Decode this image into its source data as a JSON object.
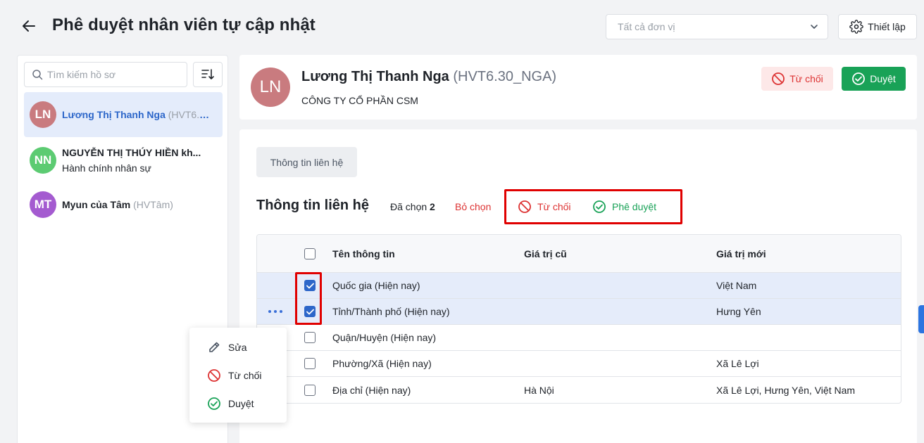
{
  "header": {
    "title": "Phê duyệt nhân viên tự cập nhật",
    "unit_select_placeholder": "Tất cả đơn vị",
    "setup_label": "Thiết lập"
  },
  "sidebar": {
    "search_placeholder": "Tìm kiếm hồ sơ",
    "items": [
      {
        "initials": "LN",
        "avatar_color": "#c97b7f",
        "name": "Lương Thị Thanh Nga",
        "code": "(HVT6.30_NGA)",
        "sub": "",
        "active": true
      },
      {
        "initials": "NN",
        "avatar_color": "#5ccb72",
        "name": "NGUYỄN THỊ THÚY HIỀN kh...",
        "code": "",
        "sub": "Hành chính nhân sự",
        "active": false
      },
      {
        "initials": "MT",
        "avatar_color": "#a45bd0",
        "name": "Myun của Tâm",
        "code": "(HVTâm)",
        "sub": "",
        "active": false
      }
    ]
  },
  "employee": {
    "initials": "LN",
    "avatar_color": "#c97b7f",
    "name": "Lương Thị Thanh Nga",
    "code": "(HVT6.30_NGA)",
    "company": "CÔNG TY CỔ PHẦN CSM",
    "reject_label": "Từ chối",
    "approve_label": "Duyệt"
  },
  "main": {
    "tab_label": "Thông tin liên hệ",
    "section_title": "Thông tin liên hệ",
    "selected_prefix": "Đã chọn",
    "selected_count": "2",
    "deselect_label": "Bỏ chọn",
    "bulk_reject_label": "Từ chối",
    "bulk_approve_label": "Phê duyệt",
    "table": {
      "headers": {
        "name": "Tên thông tin",
        "old": "Giá trị cũ",
        "new": "Giá trị mới"
      },
      "rows": [
        {
          "name": "Quốc gia (Hiện nay)",
          "old": "",
          "new": "Việt Nam",
          "checked": true
        },
        {
          "name": "Tỉnh/Thành phố (Hiện nay)",
          "old": "",
          "new": "Hưng Yên",
          "checked": true
        },
        {
          "name": "Quận/Huyện (Hiện nay)",
          "old": "",
          "new": "",
          "checked": false
        },
        {
          "name": "Phường/Xã (Hiện nay)",
          "old": "",
          "new": "Xã Lê Lợi",
          "checked": false
        },
        {
          "name": "Địa chỉ (Hiện nay)",
          "old": "Hà Nội",
          "new": "Xã Lê Lợi, Hưng Yên, Việt Nam",
          "checked": false
        }
      ]
    }
  },
  "context_menu": {
    "edit_label": "Sửa",
    "reject_label": "Từ chối",
    "approve_label": "Duyệt"
  },
  "colors": {
    "primary_blue": "#2c66c9",
    "reject_red": "#dd3333",
    "approve_green": "#19a257",
    "highlight_red": "#e00000"
  }
}
